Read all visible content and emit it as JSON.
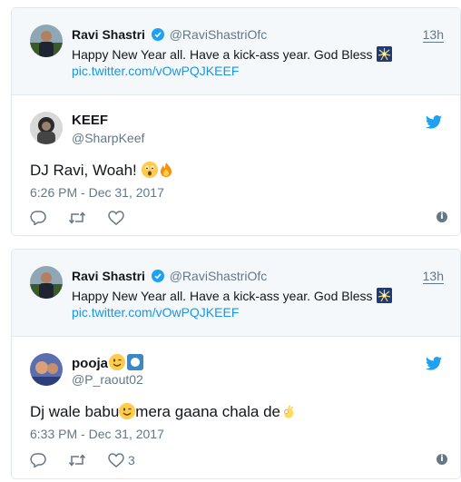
{
  "quoted_tweet": {
    "display_name": "Ravi Shastri",
    "handle": "@RaviShastriOfc",
    "time": "13h",
    "text": "Happy New Year all. Have a kick-ass year. God Bless",
    "link": "pic.twitter.com/vOwPQJKEEF",
    "emoji": "fireworks-icon"
  },
  "replies": [
    {
      "display_name": "KEEF",
      "handle": "@SharpKeef",
      "text": "DJ Ravi, Woah!",
      "emojis": [
        "astonished-face-icon",
        "fire-icon"
      ],
      "timestamp": "6:26 PM - Dec 31, 2017",
      "like_count": ""
    },
    {
      "display_name": "pooja",
      "handle": "@P_raout02",
      "name_emojis": [
        "winking-face-icon",
        "white-circle-icon"
      ],
      "text_part1": "Dj wale babu",
      "text_part2": "mera gaana chala de",
      "emojis": [
        "winking-face-icon",
        "ok-hand-icon"
      ],
      "timestamp": "6:33 PM - Dec 31, 2017",
      "like_count": "3"
    }
  ],
  "colors": {
    "twitter_blue": "#1da1f2",
    "link_blue": "#1b95e0",
    "muted": "#657786",
    "border": "#e1e8ed",
    "quoted_bg": "#f5f8fa"
  }
}
